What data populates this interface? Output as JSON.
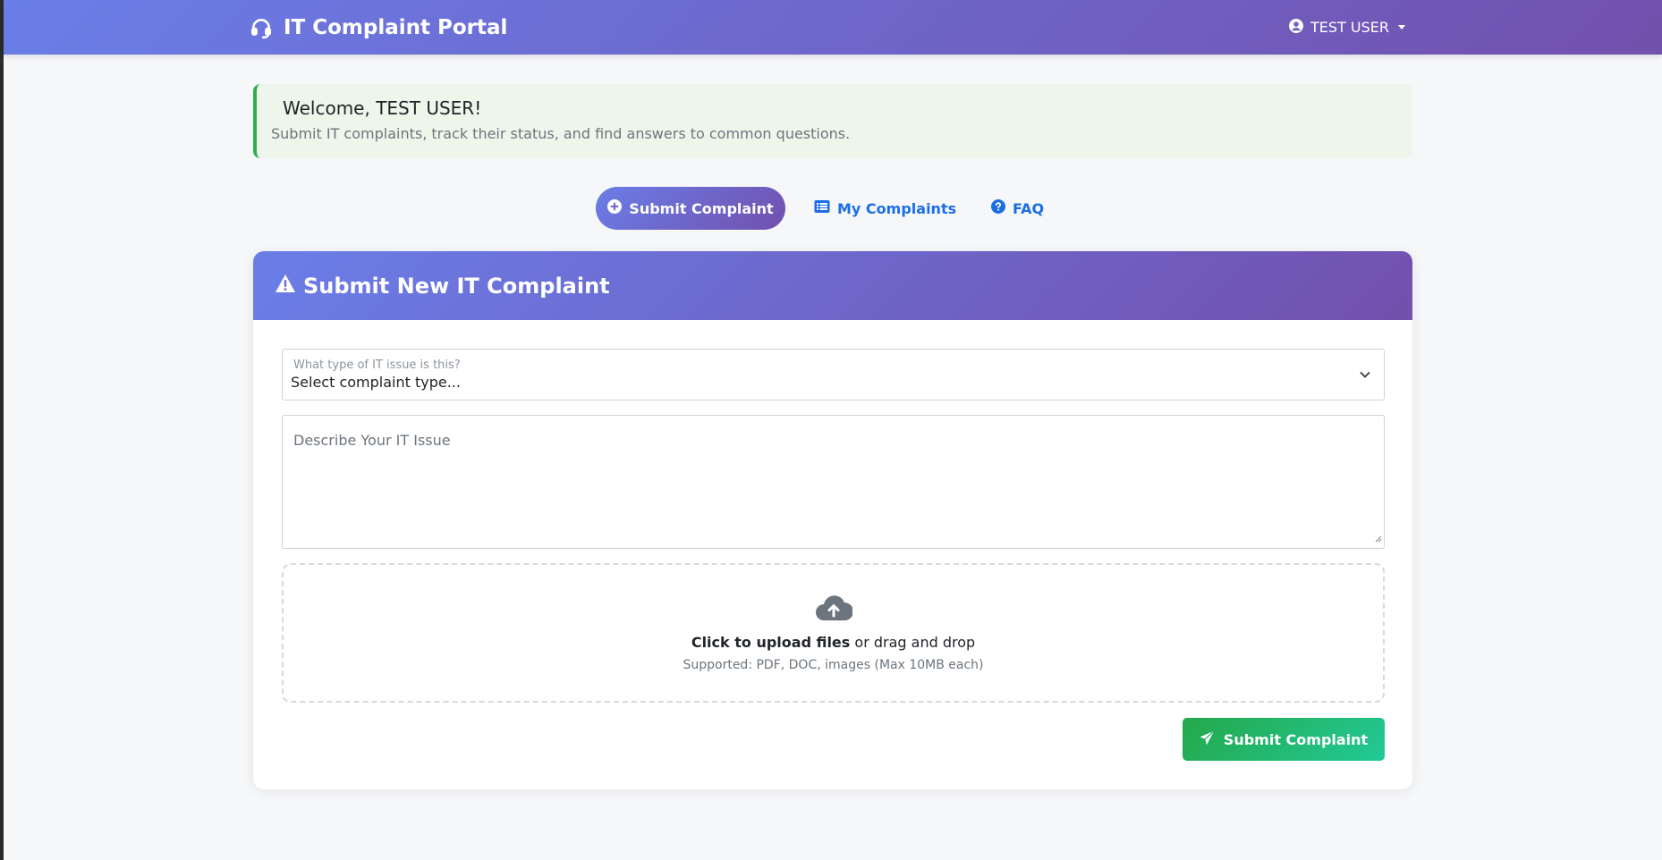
{
  "navbar": {
    "brand_icon": "headset-icon",
    "brand_title": "IT Complaint Portal",
    "user_icon": "user-circle-icon",
    "user_name": "TEST USER"
  },
  "welcome": {
    "title": "Welcome, TEST USER!",
    "subtitle": "Submit IT complaints, track their status, and find answers to common questions."
  },
  "tabs": [
    {
      "label": "Submit Complaint",
      "icon": "plus-circle-icon",
      "active": true
    },
    {
      "label": "My Complaints",
      "icon": "list-icon",
      "active": false
    },
    {
      "label": "FAQ",
      "icon": "question-circle-icon",
      "active": false
    }
  ],
  "form": {
    "header_icon": "warning-triangle-icon",
    "header_title": "Submit New IT Complaint",
    "type_label": "What type of IT issue is this?",
    "type_value": "Select complaint type...",
    "description_placeholder": "Describe Your IT Issue",
    "upload_icon": "cloud-upload-icon",
    "upload_strong": "Click to upload files",
    "upload_rest": " or drag and drop",
    "upload_supported": "Supported: PDF, DOC, images (Max 10MB each)",
    "submit_icon": "paper-plane-icon",
    "submit_label": "Submit Complaint"
  },
  "colors": {
    "gradient_start": "#6a7ee8",
    "gradient_end": "#7250ad",
    "link_blue": "#1b6ee6",
    "success_start": "#24a84a",
    "success_end": "#22c997",
    "welcome_border": "#2fae4c"
  }
}
